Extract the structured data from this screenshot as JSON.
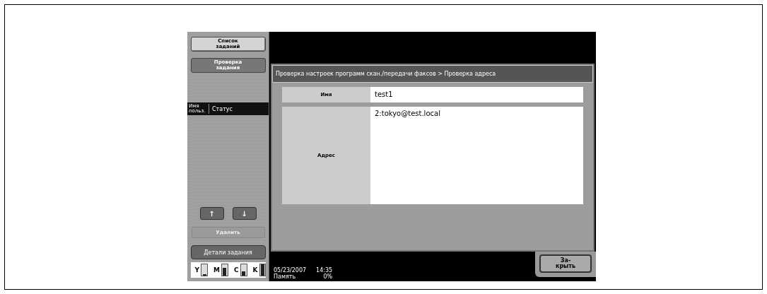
{
  "sidebar": {
    "buttons": [
      {
        "label": "Список заданий",
        "selected": false
      },
      {
        "label": "Проверка задания",
        "selected": true
      }
    ],
    "job_list": {
      "columns": [
        "Имя польз.",
        "Статус"
      ]
    },
    "scroll_buttons": [
      "↑",
      "↓"
    ],
    "delete_button": {
      "label": "Удалить",
      "disabled": true
    },
    "details_button": {
      "label": "Детали задания"
    },
    "toner": [
      {
        "label": "Y",
        "level": 0.15
      },
      {
        "label": "M",
        "level": 0.7
      },
      {
        "label": "C",
        "level": 0.35
      },
      {
        "label": "K",
        "level": 1.0
      }
    ]
  },
  "breadcrumb": "Проверка настроек программ скан./передачи факсов > Проверка адреса",
  "fields": [
    {
      "label": "Имя",
      "value": "test1"
    },
    {
      "label": "Адрес",
      "value": "2:tokyo@test.local"
    }
  ],
  "status_bar": {
    "date": "05/23/2007",
    "time": "14:35",
    "memory_label": "Память",
    "memory_value": "0%"
  },
  "close_button": "За-\nкрыть"
}
